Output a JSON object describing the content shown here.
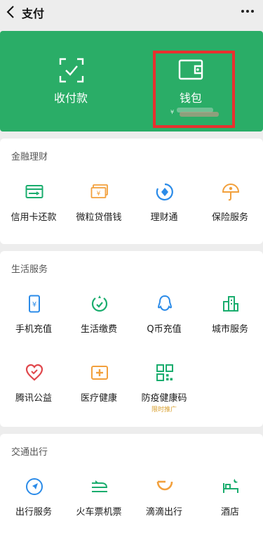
{
  "header": {
    "title": "支付"
  },
  "pay_card": {
    "receive": {
      "label": "收付款"
    },
    "wallet": {
      "label": "钱包",
      "balance_prefix": "¥"
    }
  },
  "finance": {
    "title": "金融理财",
    "items": [
      {
        "label": "信用卡还款",
        "icon": "credit-card-icon"
      },
      {
        "label": "微粒贷借钱",
        "icon": "loan-cash-icon"
      },
      {
        "label": "理财通",
        "icon": "wealth-icon"
      },
      {
        "label": "保险服务",
        "icon": "insurance-umbrella-icon"
      }
    ]
  },
  "life": {
    "title": "生活服务",
    "items": [
      {
        "label": "手机充值",
        "icon": "phone-recharge-icon"
      },
      {
        "label": "生活缴费",
        "icon": "utility-bill-icon"
      },
      {
        "label": "Q币充值",
        "icon": "qq-coin-icon"
      },
      {
        "label": "城市服务",
        "icon": "city-service-icon"
      },
      {
        "label": "腾讯公益",
        "icon": "charity-heart-icon"
      },
      {
        "label": "医疗健康",
        "icon": "medical-icon"
      },
      {
        "label": "防疫健康码",
        "icon": "qr-code-icon",
        "tag": "限时推广"
      }
    ]
  },
  "transport": {
    "title": "交通出行",
    "items": [
      {
        "label": "出行服务",
        "icon": "navigation-icon"
      },
      {
        "label": "火车票机票",
        "icon": "train-ticket-icon"
      },
      {
        "label": "滴滴出行",
        "icon": "didi-icon"
      },
      {
        "label": "酒店",
        "icon": "hotel-bed-icon"
      }
    ]
  },
  "colors": {
    "brand_green": "#2aad67",
    "highlight_red": "#e8302f",
    "icon_blue": "#2b8be8",
    "icon_orange": "#f2a03c",
    "icon_green": "#1aad6e"
  }
}
